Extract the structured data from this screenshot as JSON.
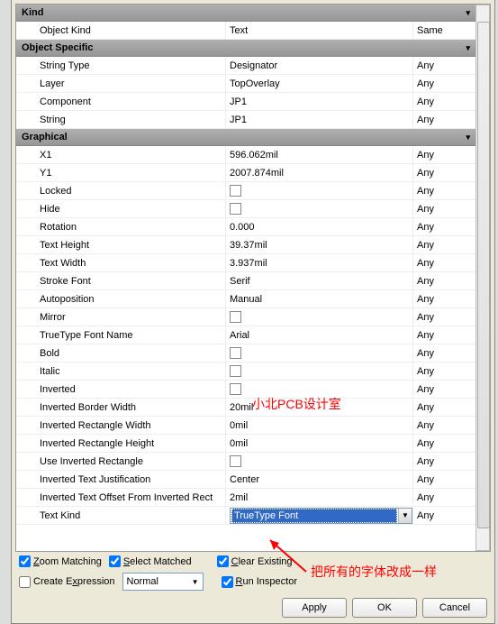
{
  "sections": {
    "kind": {
      "header": "Kind"
    },
    "objectSpecific": {
      "header": "Object Specific"
    },
    "graphical": {
      "header": "Graphical"
    }
  },
  "rows": {
    "objectKind": {
      "name": "Object Kind",
      "value": "Text",
      "scope": "Same"
    },
    "stringType": {
      "name": "String Type",
      "value": "Designator",
      "scope": "Any"
    },
    "layer": {
      "name": "Layer",
      "value": "TopOverlay",
      "scope": "Any"
    },
    "component": {
      "name": "Component",
      "value": "JP1",
      "scope": "Any"
    },
    "string": {
      "name": "String",
      "value": "JP1",
      "scope": "Any"
    },
    "x1": {
      "name": "X1",
      "value": "596.062mil",
      "scope": "Any"
    },
    "y1": {
      "name": "Y1",
      "value": "2007.874mil",
      "scope": "Any"
    },
    "locked": {
      "name": "Locked",
      "scope": "Any"
    },
    "hide": {
      "name": "Hide",
      "scope": "Any"
    },
    "rotation": {
      "name": "Rotation",
      "value": "0.000",
      "scope": "Any"
    },
    "textHeight": {
      "name": "Text Height",
      "value": "39.37mil",
      "scope": "Any"
    },
    "textWidth": {
      "name": "Text Width",
      "value": "3.937mil",
      "scope": "Any"
    },
    "strokeFont": {
      "name": "Stroke Font",
      "value": "Serif",
      "scope": "Any"
    },
    "autoposition": {
      "name": "Autoposition",
      "value": "Manual",
      "scope": "Any"
    },
    "mirror": {
      "name": "Mirror",
      "scope": "Any"
    },
    "ttfName": {
      "name": "TrueType Font Name",
      "value": "Arial",
      "scope": "Any"
    },
    "bold": {
      "name": "Bold",
      "scope": "Any"
    },
    "italic": {
      "name": "Italic",
      "scope": "Any"
    },
    "inverted": {
      "name": "Inverted",
      "scope": "Any"
    },
    "invBorderW": {
      "name": "Inverted Border Width",
      "value": "20mil",
      "scope": "Any"
    },
    "invRectW": {
      "name": "Inverted Rectangle Width",
      "value": "0mil",
      "scope": "Any"
    },
    "invRectH": {
      "name": "Inverted Rectangle Height",
      "value": "0mil",
      "scope": "Any"
    },
    "useInvRect": {
      "name": "Use Inverted Rectangle",
      "scope": "Any"
    },
    "invJustify": {
      "name": "Inverted Text Justification",
      "value": "Center",
      "scope": "Any"
    },
    "invOffset": {
      "name": "Inverted Text Offset From Inverted Rect",
      "value": "2mil",
      "scope": "Any"
    },
    "textKind": {
      "name": "Text Kind",
      "value": "TrueType Font",
      "scope": "Any"
    }
  },
  "controls": {
    "zoomMatching": "Zoom Matching",
    "selectMatched": "Select Matched",
    "clearExisting": "Clear Existing",
    "createExpression": "Create Expression",
    "normal": "Normal",
    "runInspector": "Run Inspector"
  },
  "buttons": {
    "apply": "Apply",
    "ok": "OK",
    "cancel": "Cancel"
  },
  "watermarks": {
    "w1": "小北PCB设计室",
    "w2": "把所有的字体改成一样"
  }
}
